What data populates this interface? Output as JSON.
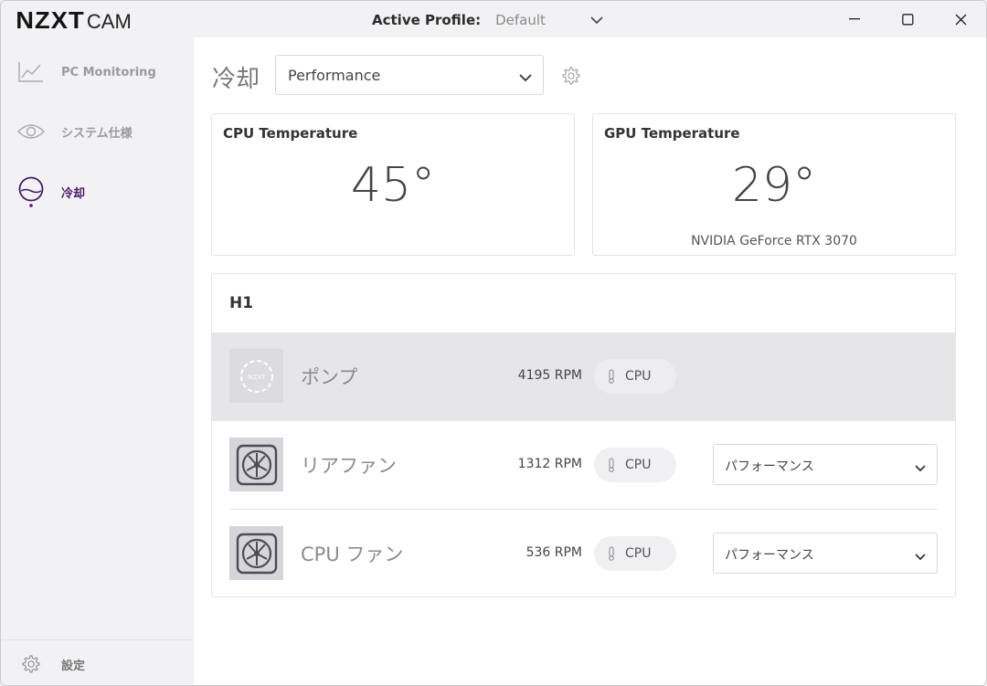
{
  "app": {
    "brand": "NZXT",
    "product": "CAM",
    "active_profile_label": "Active Profile:",
    "active_profile_value": "Default"
  },
  "sidebar": {
    "items": [
      {
        "label": "PC Monitoring",
        "icon": "line-chart-icon",
        "active": false
      },
      {
        "label": "システム仕様",
        "icon": "eye-icon",
        "active": false
      },
      {
        "label": "冷却",
        "icon": "cooling-icon",
        "active": true
      }
    ],
    "settings_label": "設定"
  },
  "main": {
    "section_title": "冷却",
    "profile_select": "Performance",
    "cpu_card": {
      "title": "CPU Temperature",
      "value": "45°"
    },
    "gpu_card": {
      "title": "GPU Temperature",
      "value": "29°",
      "device": "NVIDIA GeForce RTX 3070"
    },
    "device": {
      "name": "H1",
      "rows": [
        {
          "name": "ポンプ",
          "rpm": "4195 RPM",
          "source": "CPU",
          "mode": null,
          "selected": true
        },
        {
          "name": "リアファン",
          "rpm": "1312 RPM",
          "source": "CPU",
          "mode": "パフォーマンス",
          "selected": false
        },
        {
          "name": "CPU ファン",
          "rpm": "536 RPM",
          "source": "CPU",
          "mode": "パフォーマンス",
          "selected": false
        }
      ]
    }
  },
  "colors": {
    "accent": "#4a1a6b",
    "window_bg": "#f2f2f4",
    "content_bg": "#ffffff"
  }
}
